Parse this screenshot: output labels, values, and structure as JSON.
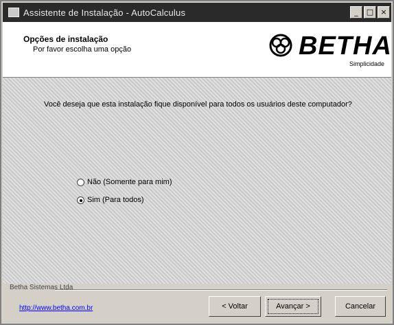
{
  "window": {
    "title": "Assistente de Instalação - AutoCalculus",
    "buttons": {
      "minimize": "_",
      "maximize": "□",
      "close": "×"
    }
  },
  "header": {
    "title": "Opções de instalação",
    "subtitle": "Por favor escolha uma opção",
    "logo": {
      "brand": "BETHA",
      "tagline": "Simplicidade"
    }
  },
  "content": {
    "question": "Você deseja que esta instalação fique disponível para todos os usuários deste computador?",
    "options": [
      {
        "label": "Não (Somente para mim)",
        "checked": false
      },
      {
        "label": "Sim (Para todos)",
        "checked": true
      }
    ]
  },
  "footer": {
    "company": "Betha Sistemas Ltda",
    "url": "http://www.betha.com.br",
    "back_label": "< Voltar",
    "next_label": "Avançar >",
    "cancel_label": "Cancelar"
  },
  "colors": {
    "titlebar": "#2a2a2a",
    "face": "#d4d0c8",
    "link": "#0000ff"
  }
}
